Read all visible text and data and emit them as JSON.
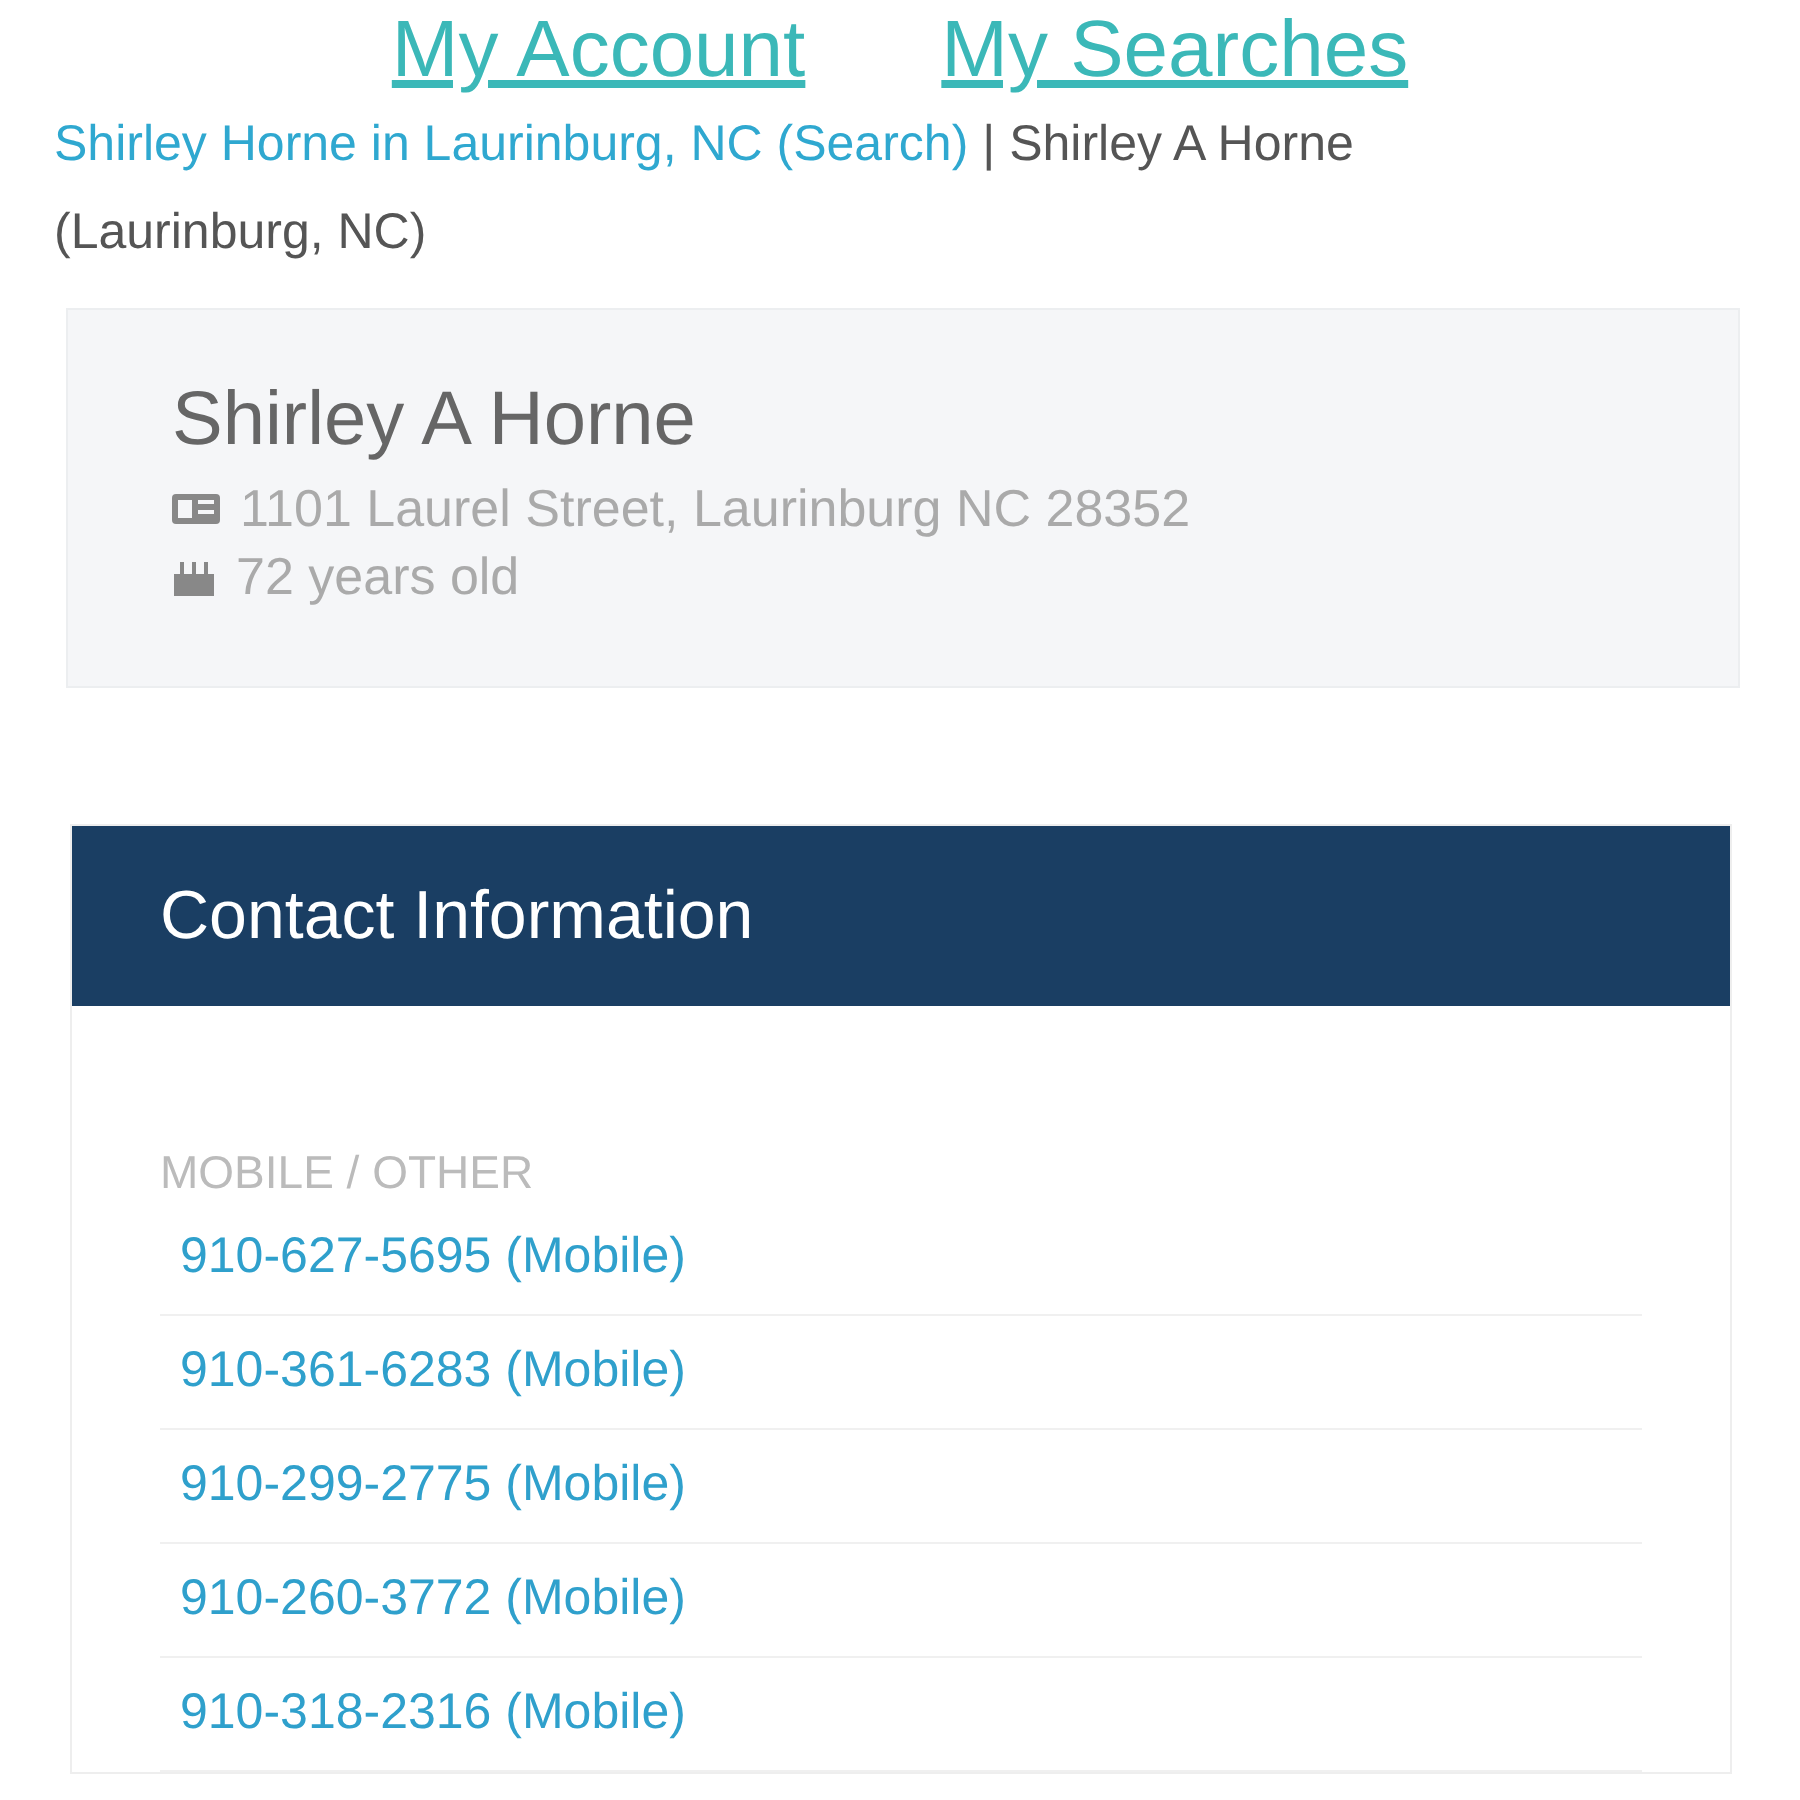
{
  "top_links": [
    "My Account",
    "My Searches"
  ],
  "breadcrumb": {
    "link": "Shirley Horne in Laurinburg, NC (Search)",
    "separator": "|",
    "current": "Shirley A Horne (Laurinburg, NC)"
  },
  "person": {
    "name": "Shirley A Horne",
    "address": "1101 Laurel Street, Laurinburg NC 28352",
    "age": "72 years old"
  },
  "contact": {
    "title": "Contact Information",
    "section": "MOBILE / OTHER",
    "phones": [
      "910-627-5695 (Mobile)",
      "910-361-6283 (Mobile)",
      "910-299-2775 (Mobile)",
      "910-260-3772 (Mobile)",
      "910-318-2316 (Mobile)"
    ]
  }
}
